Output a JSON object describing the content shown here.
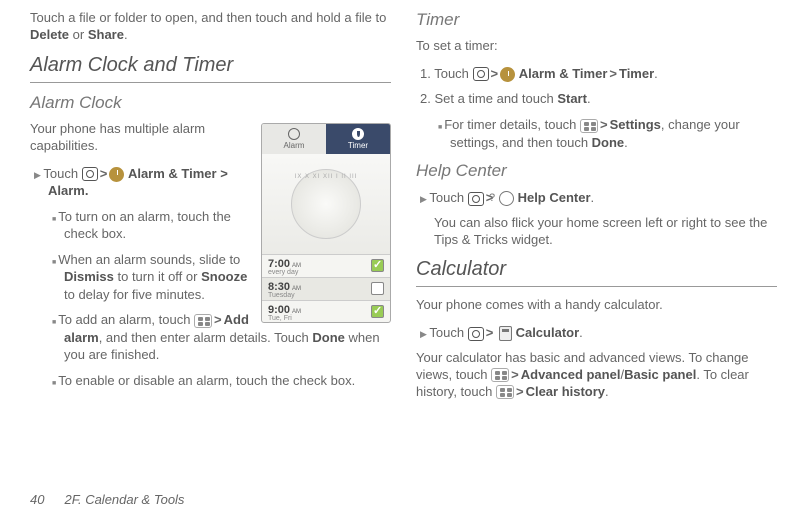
{
  "left": {
    "intro": {
      "pre": "Touch a file or folder to open, and then touch and hold a file to ",
      "b1": "Delete",
      "mid": " or ",
      "b2": "Share",
      "end": "."
    },
    "h1": "Alarm Clock and Timer",
    "h2": "Alarm Clock",
    "p2": "Your phone has multiple alarm capabilities.",
    "nav": {
      "pre": "Touch ",
      "mid": " ",
      "label": "Alarm & Timer > Alarm."
    },
    "b1": "To turn on an alarm, touch the check box.",
    "b2": {
      "pre": "When an alarm sounds, slide to ",
      "b1": "Dismiss",
      "mid": " to turn it off or ",
      "b2": "Snooze",
      "end": " to delay for five minutes."
    },
    "b3": {
      "pre": "To add an alarm, touch ",
      "b1": "Add alarm",
      "mid": ", and then enter alarm details. Touch ",
      "b2": "Done",
      "end": " when you are finished."
    },
    "b4": "To enable or disable an alarm, touch the check box."
  },
  "phone": {
    "tab1": "Alarm",
    "tab2": "Timer",
    "rows": [
      {
        "time": "7:00",
        "ampm": "AM",
        "day": "every day",
        "checked": true,
        "grey": false
      },
      {
        "time": "8:30",
        "ampm": "AM",
        "day": "Tuesday",
        "checked": false,
        "grey": true
      },
      {
        "time": "9:00",
        "ampm": "AM",
        "day": "Tue, Fri",
        "checked": true,
        "grey": false
      }
    ]
  },
  "right": {
    "h2a": "Timer",
    "p1": "To set a timer:",
    "s1": {
      "num": "1.",
      "pre": " Touch ",
      "b1": "Alarm & Timer",
      "mid": " ",
      "b2": "Timer",
      "end": "."
    },
    "s2": {
      "num": "2.",
      "pre": " Set a time and touch ",
      "b1": "Start",
      "end": "."
    },
    "s2b": {
      "pre": "For timer details, touch ",
      "b1": "Settings",
      "mid": ", change your settings, and then touch ",
      "b2": "Done",
      "end": "."
    },
    "h2b": "Help Center",
    "hc1": {
      "pre": "Touch ",
      "b1": "Help Center",
      "end": "."
    },
    "hc2": "You can also flick your home screen left or right to see the Tips & Tricks widget.",
    "h1c": "Calculator",
    "c1": "Your phone comes with a handy calculator.",
    "c2": {
      "pre": "Touch ",
      "b1": "Calculator",
      "end": "."
    },
    "c3": {
      "pre": "Your calculator has basic and advanced views. To change views, touch ",
      "b1": "Advanced panel",
      "slash": "/",
      "b2": "Basic panel",
      "mid": ". To clear history, touch ",
      "b3": "Clear history",
      "end": "."
    }
  },
  "footer": {
    "page": "40",
    "section": "2F. Calendar & Tools"
  }
}
